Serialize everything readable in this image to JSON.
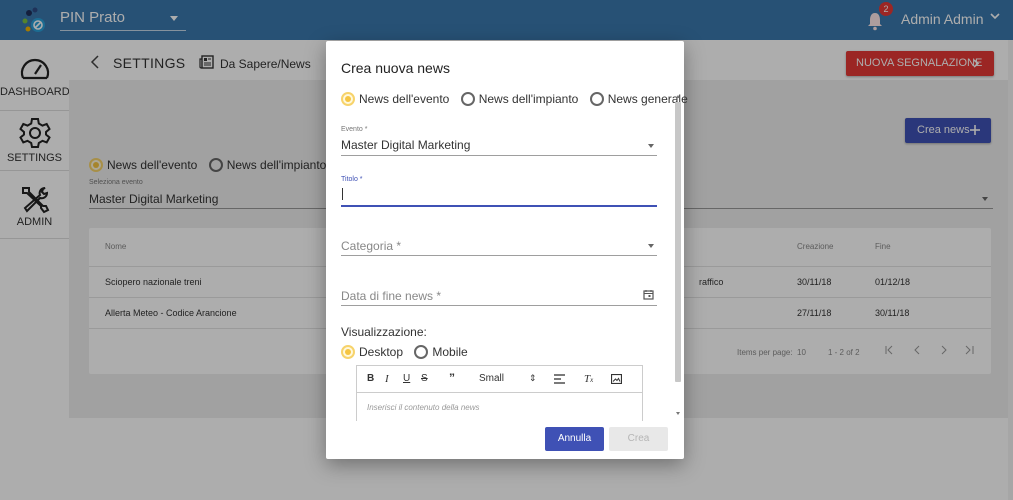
{
  "topbar": {
    "app_name": "PIN Prato",
    "notification_count": "2",
    "user_name": "Admin Admin"
  },
  "sidebar": {
    "items": [
      {
        "label": "DASHBOARD",
        "icon": "speedometer-icon"
      },
      {
        "label": "SETTINGS",
        "icon": "gear-icon"
      },
      {
        "label": "ADMIN",
        "icon": "tools-icon"
      }
    ]
  },
  "breadcrumb": {
    "section": "SETTINGS",
    "page": "Da Sapere/News"
  },
  "actions": {
    "new_report": "NUOVA SEGNALAZIONE",
    "create_news": "Crea news"
  },
  "filters": {
    "news_type_options": [
      "News dell'evento",
      "News dell'impianto"
    ],
    "selected_type": "News dell'evento",
    "event_label": "Seleziona evento",
    "event_value": "Master Digital Marketing"
  },
  "table": {
    "headers": {
      "name": "Nome",
      "created": "Creazione",
      "end": "Fine"
    },
    "rows": [
      {
        "name": "Sciopero nazionale treni",
        "category": "raffico",
        "created": "30/11/18",
        "end": "01/12/18"
      },
      {
        "name": "Allerta Meteo - Codice Arancione",
        "category": "",
        "created": "27/11/18",
        "end": "30/11/18"
      }
    ],
    "pager": {
      "items_per_page_label": "Items per page:",
      "items_per_page": "10",
      "range": "1 - 2 of 2"
    }
  },
  "dialog": {
    "title": "Crea nuova news",
    "type_options": [
      "News dell'evento",
      "News dell'impianto",
      "News generale"
    ],
    "selected_type": "News dell'evento",
    "evento_label": "Evento *",
    "evento_value": "Master Digital Marketing",
    "titolo_label": "Titolo *",
    "titolo_value": "",
    "categoria_placeholder": "Categoria *",
    "data_fine_placeholder": "Data di fine news *",
    "visualizzazione_label": "Visualizzazione:",
    "display_options": [
      "Desktop",
      "Mobile"
    ],
    "selected_display": "Desktop",
    "editor": {
      "size_option": "Small",
      "placeholder": "Inserisci il contenuto della news"
    },
    "cancel_label": "Annulla",
    "create_label": "Crea"
  },
  "colors": {
    "topbar": "#3a78ad",
    "primary": "#3f51b5",
    "danger": "#e53935",
    "radio_checked": "#f5c542"
  }
}
